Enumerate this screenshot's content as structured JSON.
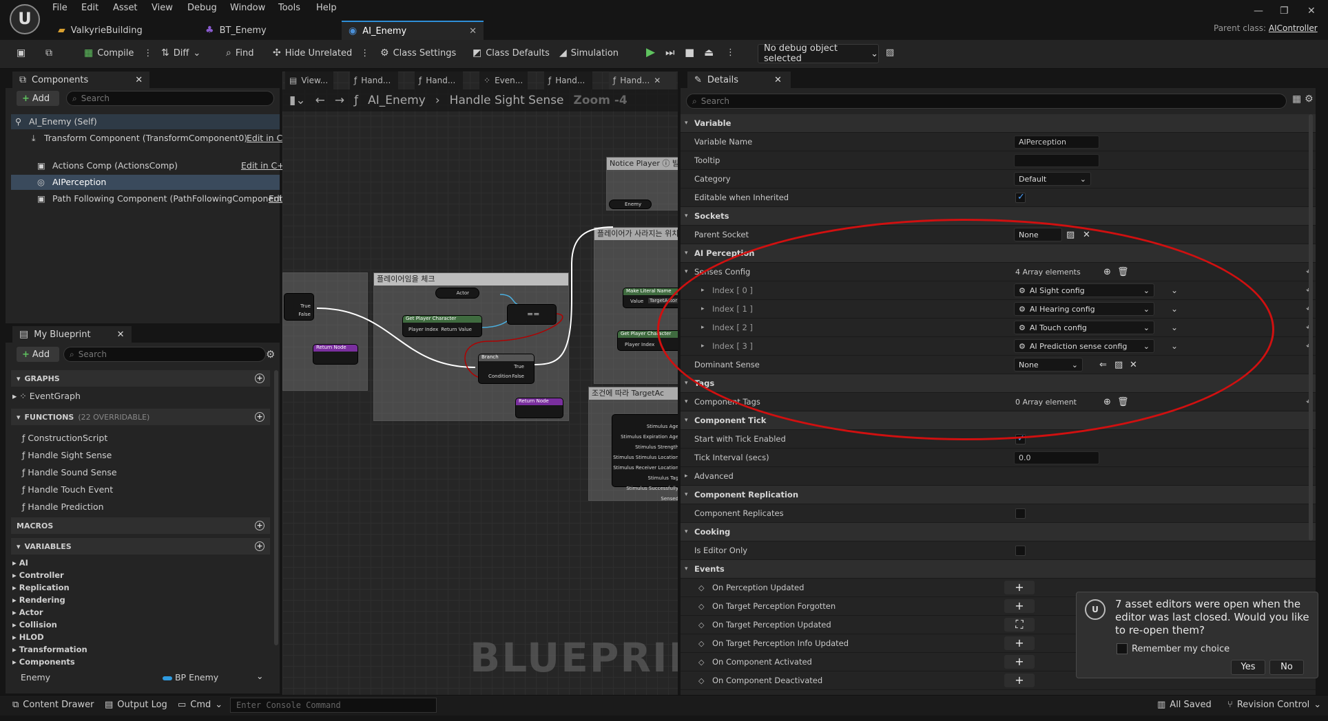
{
  "menu": [
    "File",
    "Edit",
    "Asset",
    "View",
    "Debug",
    "Window",
    "Tools",
    "Help"
  ],
  "tabs": [
    {
      "label": "ValkyrieBuilding",
      "icon": "folder-icon"
    },
    {
      "label": "BT_Enemy",
      "icon": "behavior-tree-icon"
    },
    {
      "label": "AI_Enemy",
      "icon": "blueprint-icon"
    }
  ],
  "parent_class": {
    "label": "Parent class:",
    "value": "AIController"
  },
  "toolbar": {
    "compile": "Compile",
    "diff": "Diff",
    "find": "Find",
    "hide_unrelated": "Hide Unrelated",
    "class_settings": "Class Settings",
    "class_defaults": "Class Defaults",
    "simulation": "Simulation",
    "debug_object": "No debug object selected"
  },
  "components_panel": {
    "title": "Components",
    "add": "Add",
    "search": "Search",
    "items": [
      {
        "label": "AI_Enemy (Self)",
        "action": ""
      },
      {
        "label": "Transform Component (TransformComponent0)",
        "action": "Edit in C++"
      },
      {
        "label": "Actions Comp (ActionsComp)",
        "action": "Edit in C++"
      },
      {
        "label": "AIPerception",
        "action": ""
      },
      {
        "label": "Path Following Component (PathFollowingComponent)",
        "action": "Edit"
      }
    ]
  },
  "myblueprint": {
    "title": "My Blueprint",
    "add": "Add",
    "search": "Search",
    "graphs_header": "GRAPHS",
    "graphs": [
      "EventGraph"
    ],
    "functions_header": "FUNCTIONS",
    "functions_sub": "(22 OVERRIDABLE)",
    "functions": [
      "ConstructionScript",
      "Handle Sight Sense",
      "Handle Sound Sense",
      "Handle Touch Event",
      "Handle Prediction"
    ],
    "macros_header": "MACROS",
    "variables_header": "VARIABLES",
    "variable_groups": [
      "AI",
      "Controller",
      "Replication",
      "Rendering",
      "Actor",
      "Collision",
      "HLOD",
      "Transformation",
      "Components"
    ],
    "variable_row": {
      "name": "Enemy",
      "type": "BP Enemy"
    }
  },
  "graph": {
    "tabs": [
      "View...",
      "Hand...",
      "Hand...",
      "Even...",
      "Hand...",
      "Hand..."
    ],
    "breadcrumb_root": "AI_Enemy",
    "breadcrumb_current": "Handle Sight Sense",
    "zoom": "Zoom -4",
    "watermark": "BLUEPRINT",
    "comments": [
      "Notice Player ⓘ 빌",
      "플레이어가 사라지는 위치",
      "플레이어임을 체크",
      "조건에 따라 TargetAc"
    ],
    "nodes": {
      "actor": "Actor",
      "get_player": "Get Player Character",
      "player_index": "Player Index",
      "return_value": "Return Value",
      "branch": "Branch",
      "condition": "Condition",
      "true": "True",
      "false": "False",
      "return_node": "Return Node",
      "enemy": "Enemy",
      "make_literal": "Make Literal Name",
      "value": "Value",
      "target_actor": "TargetActor",
      "stimulus": [
        "Stimulus Age",
        "Stimulus Expiration Age",
        "Stimulus Strength",
        "Stimulus Stimulus Location",
        "Stimulus Receiver Location",
        "Stimulus Tag",
        "Stimulus Successfully Sensed"
      ]
    }
  },
  "details": {
    "title": "Details",
    "search": "Search",
    "rows": [
      {
        "type": "section",
        "label": "Variable"
      },
      {
        "type": "text",
        "label": "Variable Name",
        "value": "AIPerception"
      },
      {
        "type": "text",
        "label": "Tooltip",
        "value": ""
      },
      {
        "type": "combo",
        "label": "Category",
        "value": "Default"
      },
      {
        "type": "check",
        "label": "Editable when Inherited",
        "checked": true
      },
      {
        "type": "section",
        "label": "Sockets"
      },
      {
        "type": "socket",
        "label": "Parent Socket",
        "value": "None"
      },
      {
        "type": "section",
        "label": "AI Perception"
      },
      {
        "type": "array",
        "label": "Senses Config",
        "value": "4 Array elements"
      },
      {
        "type": "index",
        "label": "Index [ 0 ]",
        "value": "AI Sight config"
      },
      {
        "type": "index",
        "label": "Index [ 1 ]",
        "value": "AI Hearing config"
      },
      {
        "type": "index",
        "label": "Index [ 2 ]",
        "value": "AI Touch config"
      },
      {
        "type": "index",
        "label": "Index [ 3 ]",
        "value": "AI Prediction sense config"
      },
      {
        "type": "dominant",
        "label": "Dominant Sense",
        "value": "None"
      },
      {
        "type": "section",
        "label": "Tags"
      },
      {
        "type": "array",
        "label": "Component Tags",
        "value": "0 Array element"
      },
      {
        "type": "section",
        "label": "Component Tick"
      },
      {
        "type": "check",
        "label": "Start with Tick Enabled",
        "checked": true
      },
      {
        "type": "text",
        "label": "Tick Interval (secs)",
        "value": "0.0"
      },
      {
        "type": "collapsed",
        "label": "Advanced"
      },
      {
        "type": "section",
        "label": "Component Replication"
      },
      {
        "type": "check",
        "label": "Component Replicates",
        "checked": false
      },
      {
        "type": "section",
        "label": "Cooking"
      },
      {
        "type": "check",
        "label": "Is Editor Only",
        "checked": false
      },
      {
        "type": "section",
        "label": "Events"
      },
      {
        "type": "event",
        "label": "On Perception Updated"
      },
      {
        "type": "event",
        "label": "On Target Perception Forgotten"
      },
      {
        "type": "event",
        "label": "On Target Perception Updated",
        "alt": true
      },
      {
        "type": "event",
        "label": "On Target Perception Info Updated"
      },
      {
        "type": "event",
        "label": "On Component Activated"
      },
      {
        "type": "event",
        "label": "On Component Deactivated"
      }
    ]
  },
  "toast": {
    "message": "7 asset editors were open when the editor was last closed. Would you like to re-open them?",
    "remember": "Remember my choice",
    "yes": "Yes",
    "no": "No"
  },
  "bottombar": {
    "content_drawer": "Content Drawer",
    "output_log": "Output Log",
    "cmd": "Cmd",
    "console_placeholder": "Enter Console Command",
    "all_saved": "All Saved",
    "revision_control": "Revision Control"
  },
  "annotation_color": "#d01010"
}
